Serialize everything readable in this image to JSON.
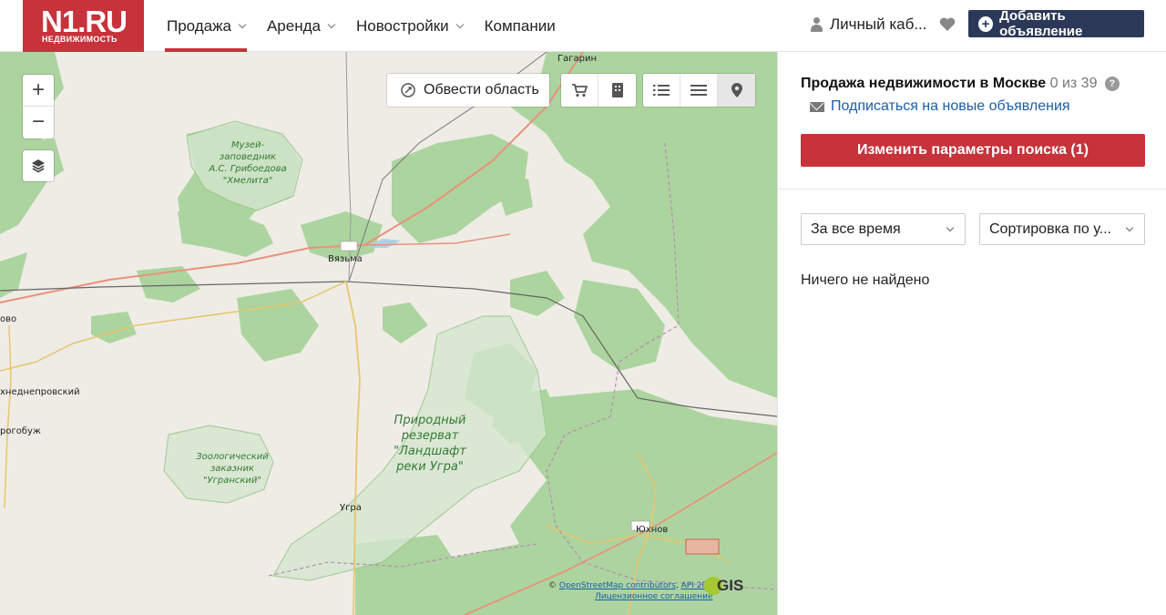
{
  "header": {
    "logo_text": "N1.RU",
    "logo_sub": "НЕДВИЖИМОСТЬ",
    "nav": [
      {
        "label": "Продажа",
        "has_dropdown": true,
        "active": true
      },
      {
        "label": "Аренда",
        "has_dropdown": true,
        "active": false
      },
      {
        "label": "Новостройки",
        "has_dropdown": true,
        "active": false
      },
      {
        "label": "Компании",
        "has_dropdown": false,
        "active": false
      }
    ],
    "account_label": "Личный каб...",
    "favorites_icon": "heart-icon",
    "add_button_label": "Добавить объявление",
    "accent_color": "#c8323a",
    "add_button_color": "#2c3858"
  },
  "map": {
    "zoom_in": "+",
    "zoom_out": "−",
    "draw_area_label": "Обвести область",
    "tools": [
      "cart-icon",
      "building-icon",
      "list-icon",
      "menu-icon",
      "pin-icon"
    ],
    "selected_tool": "pin-icon",
    "labels": {
      "gagarin": "Гагарин",
      "vyazma": "Вязьма",
      "ugra": "Угра",
      "yukhnov": "Юхнов",
      "verkhnedneprovsky": "хнеднепровский",
      "dorogobuzh": "рогобуж",
      "ovo": "ово"
    },
    "reserves": {
      "museum": [
        "Музей-",
        "заповедник",
        "А.С. Грибоедова",
        "\"Хмелита\""
      ],
      "ugra_park": [
        "Природный",
        "резерват",
        "\"Ландшафт",
        "реки Угра\""
      ],
      "zoological": [
        "Зоологический",
        "заказник",
        "\"Угранский\""
      ]
    },
    "attribution": {
      "prefix": "©",
      "osm": "OpenStreetMap contributors",
      "sep": ",",
      "api": "API 2ГИС",
      "license": "Лицензионное соглашение"
    },
    "provider_logo": "GIS"
  },
  "sidebar": {
    "title": "Продажа недвижимости в Москве",
    "count": "0 из 39",
    "help": "?",
    "subscribe_label": "Подписаться на новые объявления",
    "change_params_label": "Изменить параметры поиска (1)",
    "period_select": "За все время",
    "sort_select": "Сортировка по у...",
    "empty_message": "Ничего не найдено"
  }
}
